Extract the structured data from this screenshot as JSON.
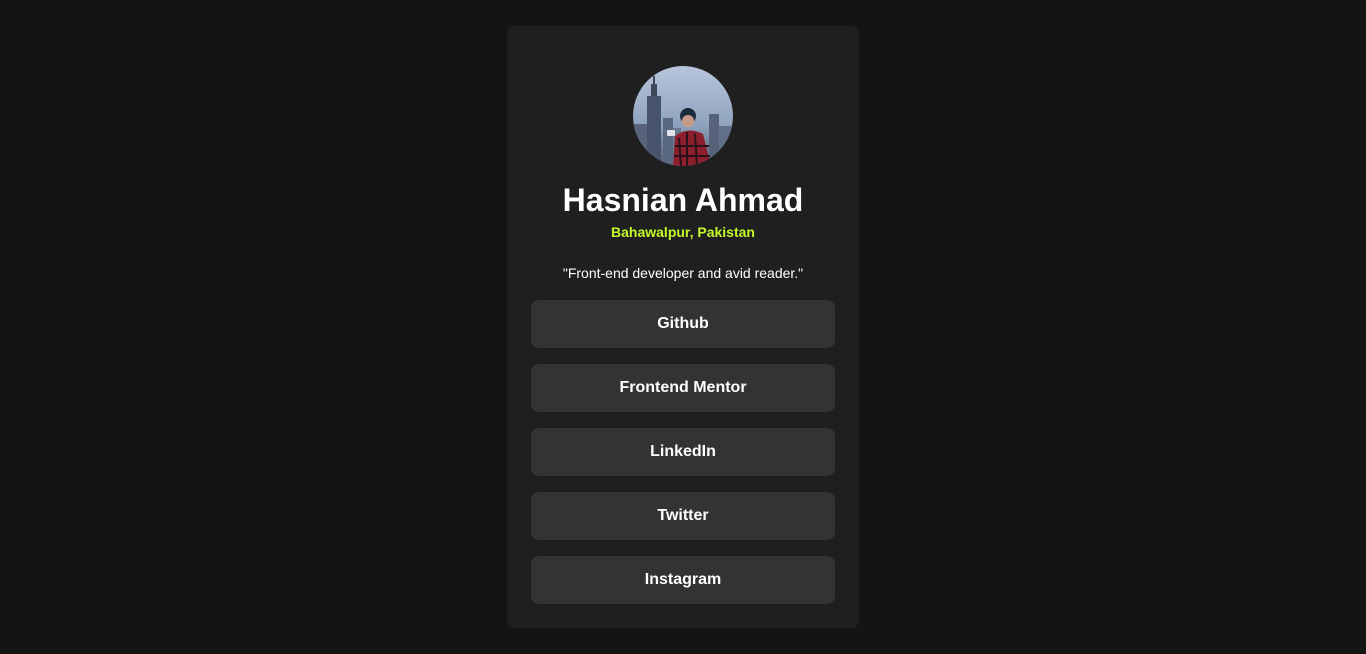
{
  "profile": {
    "name": "Hasnian Ahmad",
    "location": "Bahawalpur, Pakistan",
    "bio": "\"Front-end developer and avid reader.\""
  },
  "links": [
    {
      "label": "Github"
    },
    {
      "label": "Frontend Mentor"
    },
    {
      "label": "LinkedIn"
    },
    {
      "label": "Twitter"
    },
    {
      "label": "Instagram"
    }
  ],
  "colors": {
    "page_background": "#141414",
    "card_background": "#1f1f1f",
    "button_background": "#333333",
    "accent": "#c4f82a",
    "text": "#ffffff"
  }
}
